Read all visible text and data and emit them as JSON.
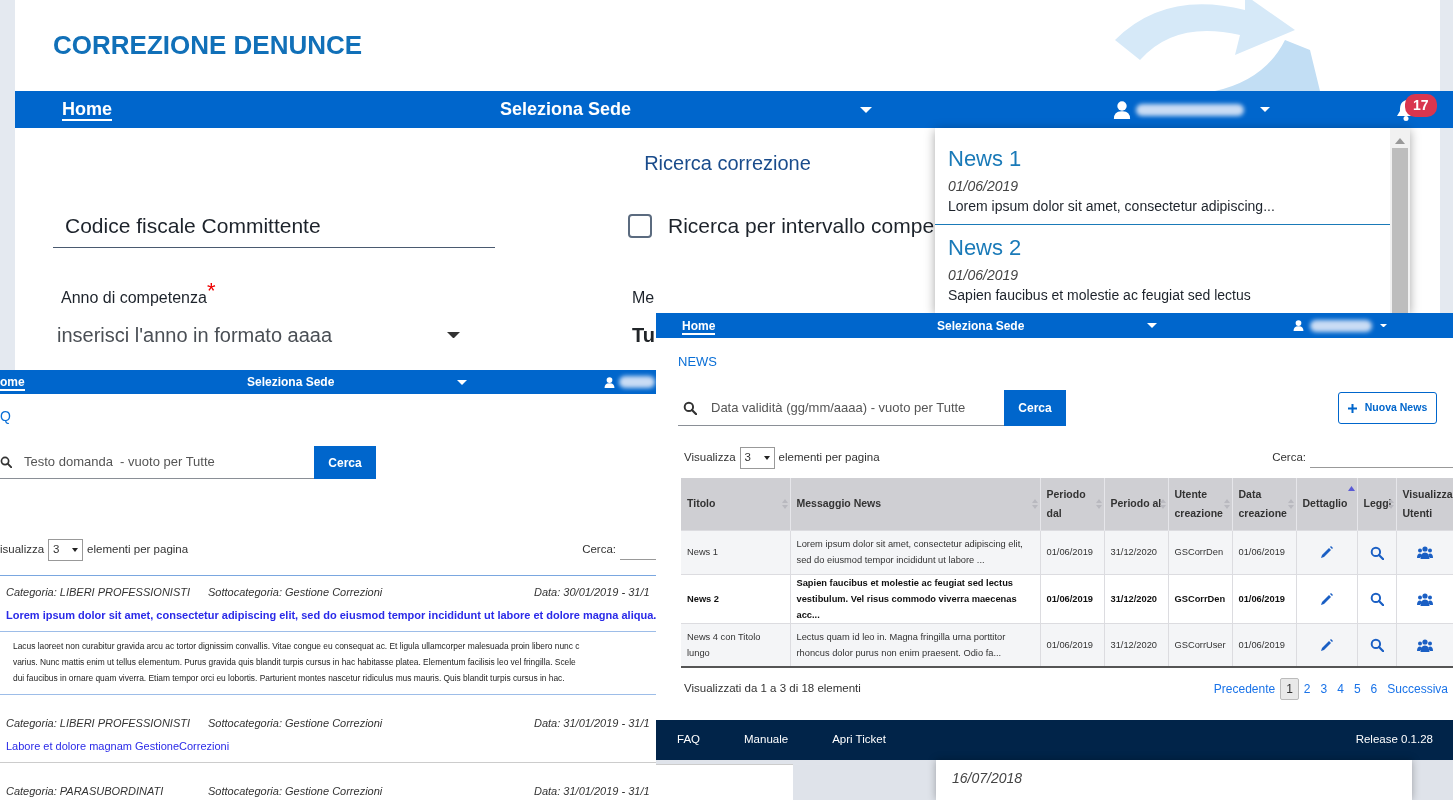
{
  "main_window": {
    "title": "CORREZIONE DENUNCE",
    "nav": {
      "items": [
        {
          "label": "Home",
          "active": true
        }
      ],
      "branch": "Seleziona Sede",
      "notification_count": "17"
    },
    "heading": "Ricerca correzione",
    "fiscal_code": {
      "placeholder": "Codice fiscale Committente"
    },
    "interval_checkbox": {
      "label": "Ricerca per intervallo compe",
      "checked": false
    },
    "year": {
      "label": "Anno di competenza",
      "required_mark": "*",
      "placeholder": "inserisci l'anno in formato aaaa"
    },
    "month": {
      "label": "Me",
      "value": "Tu"
    },
    "notifications": [
      {
        "title": "News 1",
        "date": "01/06/2019",
        "excerpt": "Lorem ipsum dolor sit amet, consectetur adipiscing..."
      },
      {
        "title": "News 2",
        "date": "01/06/2019",
        "excerpt": "Sapien faucibus et molestie ac feugiat sed lectus"
      }
    ]
  },
  "news_page": {
    "nav": {
      "items": [
        {
          "label": "Home",
          "active": true
        }
      ],
      "branch": "Seleziona Sede"
    },
    "section_title": "NEWS",
    "search": {
      "placeholder": "Data validità (gg/mm/aaaa) - vuoto per Tutte",
      "button": "Cerca"
    },
    "new_button": "Nuova News",
    "page_size": {
      "prefix": "Visualizza",
      "value": "3",
      "suffix": "elementi per pagina"
    },
    "filter_label": "Cerca:",
    "table": {
      "columns": [
        {
          "label": "Titolo",
          "kind": "text",
          "sortable": true,
          "sorted": false
        },
        {
          "label": "Messaggio News",
          "kind": "text",
          "sortable": true,
          "sorted": false
        },
        {
          "label": "Periodo dal",
          "kind": "text",
          "sortable": true,
          "sorted": false
        },
        {
          "label": "Periodo al",
          "kind": "text",
          "sortable": true,
          "sorted": false
        },
        {
          "label": "Utente creazione",
          "kind": "text",
          "sortable": true,
          "sorted": false
        },
        {
          "label": "Data creazione",
          "kind": "text",
          "sortable": true,
          "sorted": false
        },
        {
          "label": "Dettaglio",
          "kind": "edit",
          "sortable": true,
          "sorted": true
        },
        {
          "label": "Leggi",
          "kind": "view",
          "sortable": true,
          "sorted": false
        },
        {
          "label": "Visualizza Utenti",
          "kind": "users",
          "sortable": false
        }
      ],
      "rows": [
        {
          "unread": false,
          "cells": [
            "News 1",
            "Lorem ipsum dolor sit amet, consectetur adipiscing elit, sed do eiusmod tempor incididunt ut labore ...",
            "01/06/2019",
            "31/12/2020",
            "GSCorrDen",
            "01/06/2019"
          ]
        },
        {
          "unread": true,
          "cells": [
            "News 2",
            "Sapien faucibus et molestie ac feugiat sed lectus vestibulum. Vel risus commodo viverra maecenas acc...",
            "01/06/2019",
            "31/12/2020",
            "GSCorrDen",
            "01/06/2019"
          ]
        },
        {
          "unread": false,
          "cells": [
            "News 4 con Titolo lungo",
            "Lectus quam id leo in. Magna fringilla urna porttitor rhoncus dolor purus non enim praesent. Odio fa...",
            "01/06/2019",
            "31/12/2020",
            "GSCorrUser",
            "01/06/2019"
          ]
        }
      ]
    },
    "summary": "Visualizzati da 1 a 3 di 18 elementi",
    "pagination": {
      "previous": "Precedente",
      "next": "Successiva",
      "pages": [
        {
          "label": "1",
          "selected": true
        },
        {
          "label": "2",
          "selected": false
        },
        {
          "label": "3",
          "selected": false
        },
        {
          "label": "4",
          "selected": false
        },
        {
          "label": "5",
          "selected": false
        },
        {
          "label": "6",
          "selected": false
        }
      ]
    },
    "footer": {
      "links": [
        "FAQ",
        "Manuale",
        "Apri Ticket"
      ],
      "release": "Release 0.1.28"
    },
    "below_card": {
      "date": "16/07/2018"
    }
  },
  "faq_page": {
    "nav": {
      "items": [
        {
          "label": "ome",
          "active": true
        }
      ],
      "branch": "Seleziona Sede"
    },
    "section_title": "Q",
    "search": {
      "placeholder": "Testo domanda  - vuoto per Tutte",
      "button": "Cerca"
    },
    "page_size": {
      "prefix": "isualizza",
      "value": "3",
      "suffix": "elementi per pagina"
    },
    "filter_label": "Cerca:",
    "items": [
      {
        "category": "Categoria: LIBERI PROFESSIONISTI",
        "subcategory": "Sottocategoria: Gestione Correzioni",
        "date": "Data: 30/01/2019 - 31/1",
        "question": "Lorem ipsum dolor sit amet, consectetur adipiscing elit, sed do eiusmod tempor incididunt ut labore et dolore magna aliqua.",
        "expanded": true,
        "answer_lines": [
          "Lacus laoreet non curabitur gravida arcu ac tortor dignissim convallis. Vitae congue eu consequat ac. Et ligula ullamcorper malesuada proin libero nunc c",
          "varius. Nunc mattis enim ut tellus elementum. Purus gravida quis blandit turpis cursus in hac habitasse platea. Elementum facilisis leo vel fringilla. Scele",
          "dui faucibus in ornare quam viverra. Etiam tempor orci eu lobortis. Parturient montes nascetur ridiculus mus mauris. Quis blandit turpis cursus in hac."
        ]
      },
      {
        "category": "Categoria: LIBERI PROFESSIONISTI",
        "subcategory": "Sottocategoria: Gestione Correzioni",
        "date": "Data: 31/01/2019 - 31/1",
        "question": "Labore et dolore magnam GestioneCorrezioni",
        "expanded": false
      },
      {
        "category": "Categoria: PARASUBORDINATI",
        "subcategory": "Sottocategoria: Gestione Correzioni",
        "date": "Data: 31/01/2019 - 31/1",
        "expanded": false
      }
    ]
  }
}
